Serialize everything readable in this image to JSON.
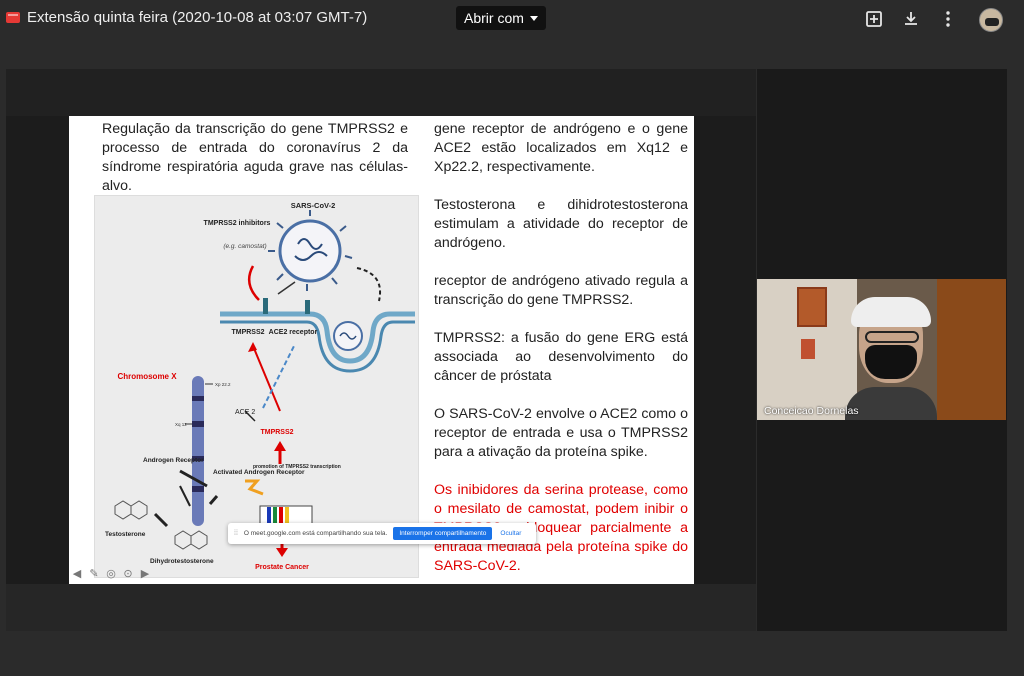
{
  "window": {
    "title": "Extensão quinta feira (2020-10-08 at 03:07 GMT-7)",
    "open_with_label": "Abrir com"
  },
  "toolbar": {
    "icons": [
      "add-to-drive-icon",
      "download-icon",
      "more-vert-icon",
      "account-avatar"
    ]
  },
  "slide": {
    "left_heading": "Regulação da transcrição do gene TMPRSS2 e processo de entrada do coronavírus 2 da síndrome respiratória aguda grave nas células-alvo.",
    "paragraphs": [
      {
        "text": "gene receptor de andrógeno e o gene ACE2 estão localizados em Xq12 e Xp22.2, respectivamente.",
        "color": "#222222"
      },
      {
        "text": "Testosterona e dihidrotestosterona estimulam a atividade do receptor de andrógeno.",
        "color": "#222222"
      },
      {
        "text": "receptor de andrógeno ativado regula a transcrição do gene TMPRSS2.",
        "color": "#222222"
      },
      {
        "text": "TMPRSS2: a fusão do gene ERG está associada ao desenvolvimento do câncer de próstata",
        "color": "#222222"
      },
      {
        "text": "O SARS-CoV-2 envolve o ACE2 como o receptor de entrada e usa o TMPRSS2 para a ativação da proteína spike.",
        "color": "#222222"
      },
      {
        "text": "Os inibidores da serina protease, como o mesilato de camostat, podem inibir o TMPRSS2 e bloquear parcialmente a entrada mediada pela proteína spike do SARS-CoV-2.",
        "color": "#e00000"
      }
    ],
    "figure": {
      "sars_label": "SARS-CoV-2",
      "inhibitors_label": "TMPRSS2 inhibitors",
      "inhibitors_example": "(e.g. camostat)",
      "tmprss2_label": "TMPRSS2",
      "ace2_receptor_label": "ACE2 receptor",
      "chromosome_label": "Chromosome X",
      "xp_label": "Xp 22.2",
      "xq_label": "Xq 12",
      "ace2_label": "ACE 2",
      "tmprss2_red_label": "TMPRSS2",
      "androgen_receptor_label": "Androgen Receptor",
      "activated_label": "Activated Androgen Receptor",
      "promotion_label": "promotion of TMPRSS2 transcription",
      "testosterone_label": "Testosterone",
      "dht_label": "Dihydrotestosterone",
      "prostate_label": "Prostate Cancer"
    }
  },
  "share_notice": {
    "message": "O meet.google.com está compartilhando sua tela.",
    "stop_label": "Interromper compartilhamento",
    "hide_label": "Ocultar"
  },
  "participant": {
    "name": "Conceicao Dornelas"
  },
  "colors": {
    "accent": "#1a73e8",
    "red_text": "#e00000"
  }
}
